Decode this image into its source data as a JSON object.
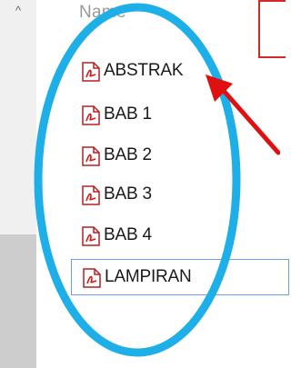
{
  "explorer": {
    "column_header": "Name",
    "scroll_up_glyph": "^",
    "files": [
      {
        "name": "ABSTRAK",
        "icon": "pdf-file-icon",
        "selected": false
      },
      {
        "name": "BAB 1",
        "icon": "pdf-file-icon",
        "selected": false
      },
      {
        "name": "BAB 2",
        "icon": "pdf-file-icon",
        "selected": false
      },
      {
        "name": "BAB 3",
        "icon": "pdf-file-icon",
        "selected": false
      },
      {
        "name": "BAB 4",
        "icon": "pdf-file-icon",
        "selected": false
      },
      {
        "name": "LAMPIRAN",
        "icon": "pdf-file-icon",
        "selected": true
      }
    ]
  },
  "annotations": {
    "circle_color": "#1eaee8",
    "arrow_color": "#e01010",
    "callout_border_color": "#d62828"
  }
}
